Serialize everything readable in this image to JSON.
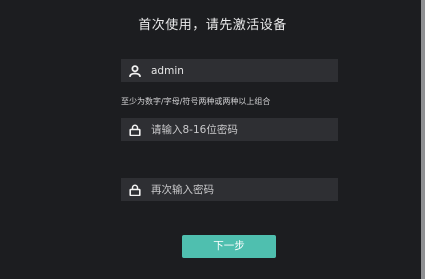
{
  "header": {
    "title": "首次使用，请先激活设备"
  },
  "username_field": {
    "icon": "user-icon",
    "value": "admin"
  },
  "password_hint": "至少为数字/字母/符号两种或两种以上组合",
  "password_field": {
    "icon": "lock-icon",
    "placeholder": "请输入8-16位密码"
  },
  "confirm_field": {
    "icon": "lock-icon",
    "placeholder": "再次输入密码"
  },
  "actions": {
    "next_label": "下一步"
  },
  "colors": {
    "background": "#1c1d20",
    "field_background": "#2e2f33",
    "accent": "#4fbfaf"
  }
}
